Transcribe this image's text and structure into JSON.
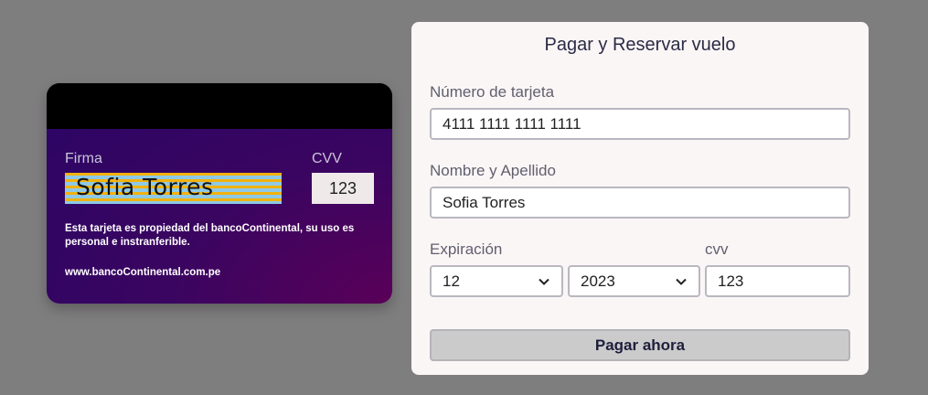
{
  "card": {
    "signature_label": "Firma",
    "cvv_label": "CVV",
    "signature_name": "Sofia Torres",
    "cvv_value": "123",
    "legal_text": "Esta tarjeta es propiedad del bancoContinental, su uso es personal e instranferible.",
    "website": "www.bancoContinental.com.pe"
  },
  "form": {
    "title": "Pagar y Reservar vuelo",
    "card_number_label": "Número de tarjeta",
    "card_number_value": "4111 1111 1111 1111",
    "name_label": "Nombre y Apellido",
    "name_value": "Sofia Torres",
    "expiration_label": "Expiración",
    "month_value": "12",
    "year_value": "2023",
    "cvv_label": "cvv",
    "cvv_value": "123",
    "submit_label": "Pagar ahora"
  },
  "icons": {
    "select_arrow": "chevron-down-icon"
  },
  "colors": {
    "background": "#7f7e7f",
    "card_primary": "#2b0566",
    "card_accent": "#5a0058"
  }
}
